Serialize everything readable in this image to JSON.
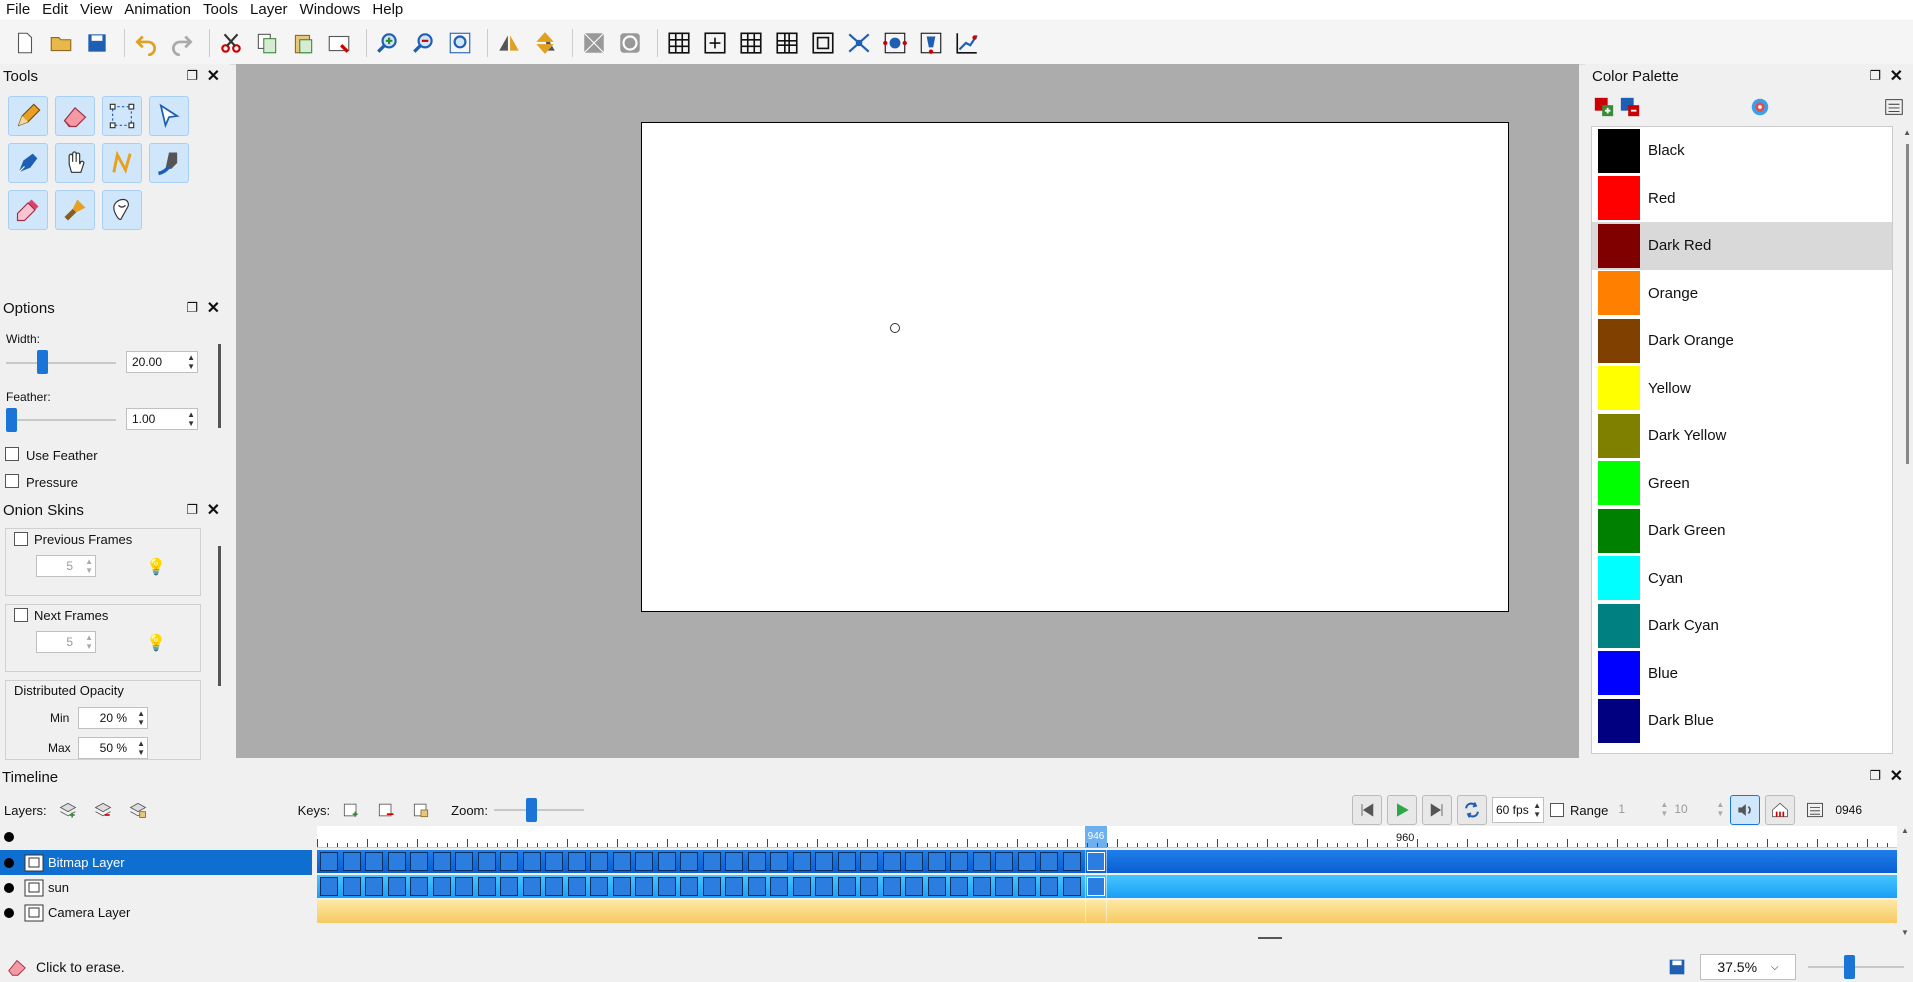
{
  "menu": [
    "File",
    "Edit",
    "View",
    "Animation",
    "Tools",
    "Layer",
    "Windows",
    "Help"
  ],
  "panels": {
    "tools": {
      "title": "Tools"
    },
    "options": {
      "title": "Options",
      "width_label": "Width:",
      "width_value": "20.00",
      "feather_label": "Feather:",
      "feather_value": "1.00",
      "use_feather_label": "Use Feather",
      "pressure_label": "Pressure"
    },
    "onion": {
      "title": "Onion Skins",
      "previous_frames_label": "Previous Frames",
      "previous_frames_value": "5",
      "next_frames_label": "Next Frames",
      "next_frames_value": "5",
      "distributed_opacity_label": "Distributed Opacity",
      "min_label": "Min",
      "min_value": "20 %",
      "max_label": "Max",
      "max_value": "50 %"
    },
    "palette": {
      "title": "Color Palette",
      "colors": [
        {
          "name": "Black",
          "hex": "#000000"
        },
        {
          "name": "Red",
          "hex": "#ff0000"
        },
        {
          "name": "Dark Red",
          "hex": "#800000"
        },
        {
          "name": "Orange",
          "hex": "#ff8000"
        },
        {
          "name": "Dark Orange",
          "hex": "#804000"
        },
        {
          "name": "Yellow",
          "hex": "#ffff00"
        },
        {
          "name": "Dark Yellow",
          "hex": "#808000"
        },
        {
          "name": "Green",
          "hex": "#00ff00"
        },
        {
          "name": "Dark Green",
          "hex": "#008000"
        },
        {
          "name": "Cyan",
          "hex": "#00ffff"
        },
        {
          "name": "Dark Cyan",
          "hex": "#008080"
        },
        {
          "name": "Blue",
          "hex": "#0000ff"
        },
        {
          "name": "Dark Blue",
          "hex": "#000080"
        }
      ],
      "selected": "Dark Red"
    }
  },
  "timeline": {
    "title": "Timeline",
    "layers_label": "Layers:",
    "keys_label": "Keys:",
    "zoom_label": "Zoom:",
    "fps": "60 fps",
    "range_label": "Range",
    "range_start": "1",
    "range_end": "10",
    "current_frame": "0946",
    "ruler_current": "946",
    "ruler_mark": "960",
    "layers": [
      {
        "name": "Bitmap Layer",
        "selected": true
      },
      {
        "name": "sun",
        "selected": false
      },
      {
        "name": "Camera Layer",
        "selected": false
      }
    ]
  },
  "status": {
    "message": "Click to erase.",
    "zoom": "37.5%"
  }
}
